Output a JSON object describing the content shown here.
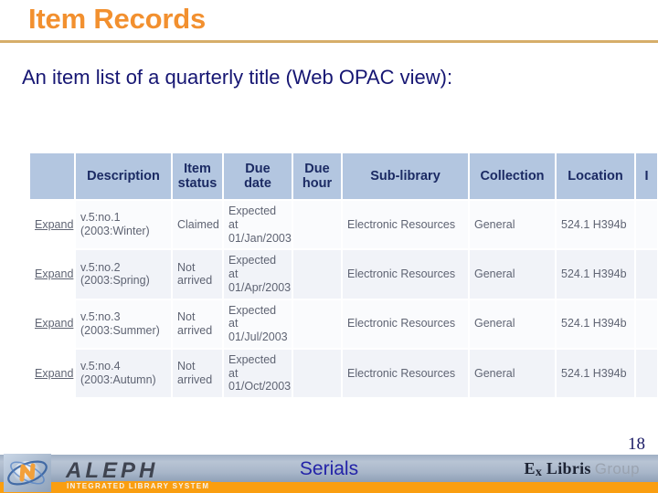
{
  "slide": {
    "title": "Item Records",
    "subtitle": "An item list of a quarterly title (Web OPAC view):",
    "page_number": "18",
    "title_color": "#F2902F",
    "rule_color": "#D6AE6A",
    "subtitle_color": "#161673"
  },
  "opac_table": {
    "headers": {
      "expand": "",
      "description": "Description",
      "item_status_line1": "Item",
      "item_status_line2": "status",
      "due_date_line1": "Due",
      "due_date_line2": "date",
      "due_hour_line1": "Due",
      "due_hour_line2": "hour",
      "sub_library": "Sub-library",
      "collection": "Collection",
      "location": "Location",
      "partial": "I"
    },
    "header_bg": "#B3C6E0",
    "header_text_color": "#1B2A63",
    "rows": [
      {
        "expand": "Expand",
        "desc_line1": "v.5:no.1",
        "desc_line2": "(2003:Winter)",
        "status_line1": "Claimed",
        "status_line2": "",
        "due_date_line1": "Expected at",
        "due_date_line2": "01/Jan/2003",
        "due_hour": "",
        "sub_library": "Electronic Resources",
        "collection": "General",
        "location": "524.1 H394b",
        "partial": ""
      },
      {
        "expand": "Expand",
        "desc_line1": "v.5:no.2",
        "desc_line2": "(2003:Spring)",
        "status_line1": "Not",
        "status_line2": "arrived",
        "due_date_line1": "Expected at",
        "due_date_line2": "01/Apr/2003",
        "due_hour": "",
        "sub_library": "Electronic Resources",
        "collection": "General",
        "location": "524.1 H394b",
        "partial": ""
      },
      {
        "expand": "Expand",
        "desc_line1": "v.5:no.3",
        "desc_line2": "(2003:Summer)",
        "status_line1": "Not",
        "status_line2": "arrived",
        "due_date_line1": "Expected at",
        "due_date_line2": "01/Jul/2003",
        "due_hour": "",
        "sub_library": "Electronic Resources",
        "collection": "General",
        "location": "524.1 H394b",
        "partial": ""
      },
      {
        "expand": "Expand",
        "desc_line1": "v.5:no.4",
        "desc_line2": "(2003:Autumn)",
        "status_line1": "Not",
        "status_line2": "arrived",
        "due_date_line1": "Expected at",
        "due_date_line2": "01/Oct/2003",
        "due_hour": "",
        "sub_library": "Electronic Resources",
        "collection": "General",
        "location": "524.1 H394b",
        "partial": ""
      }
    ]
  },
  "footer": {
    "center_label": "Serials",
    "aleph_wordmark": "ALEPH",
    "aleph_tagline": "INTEGRATED LIBRARY SYSTEM",
    "exlibris_ex": "E",
    "exlibris_x": "x",
    "exlibris_libris": " Libris",
    "exlibris_group": "Group",
    "orange_color": "#FA9E10",
    "label_color": "#2323A8"
  }
}
